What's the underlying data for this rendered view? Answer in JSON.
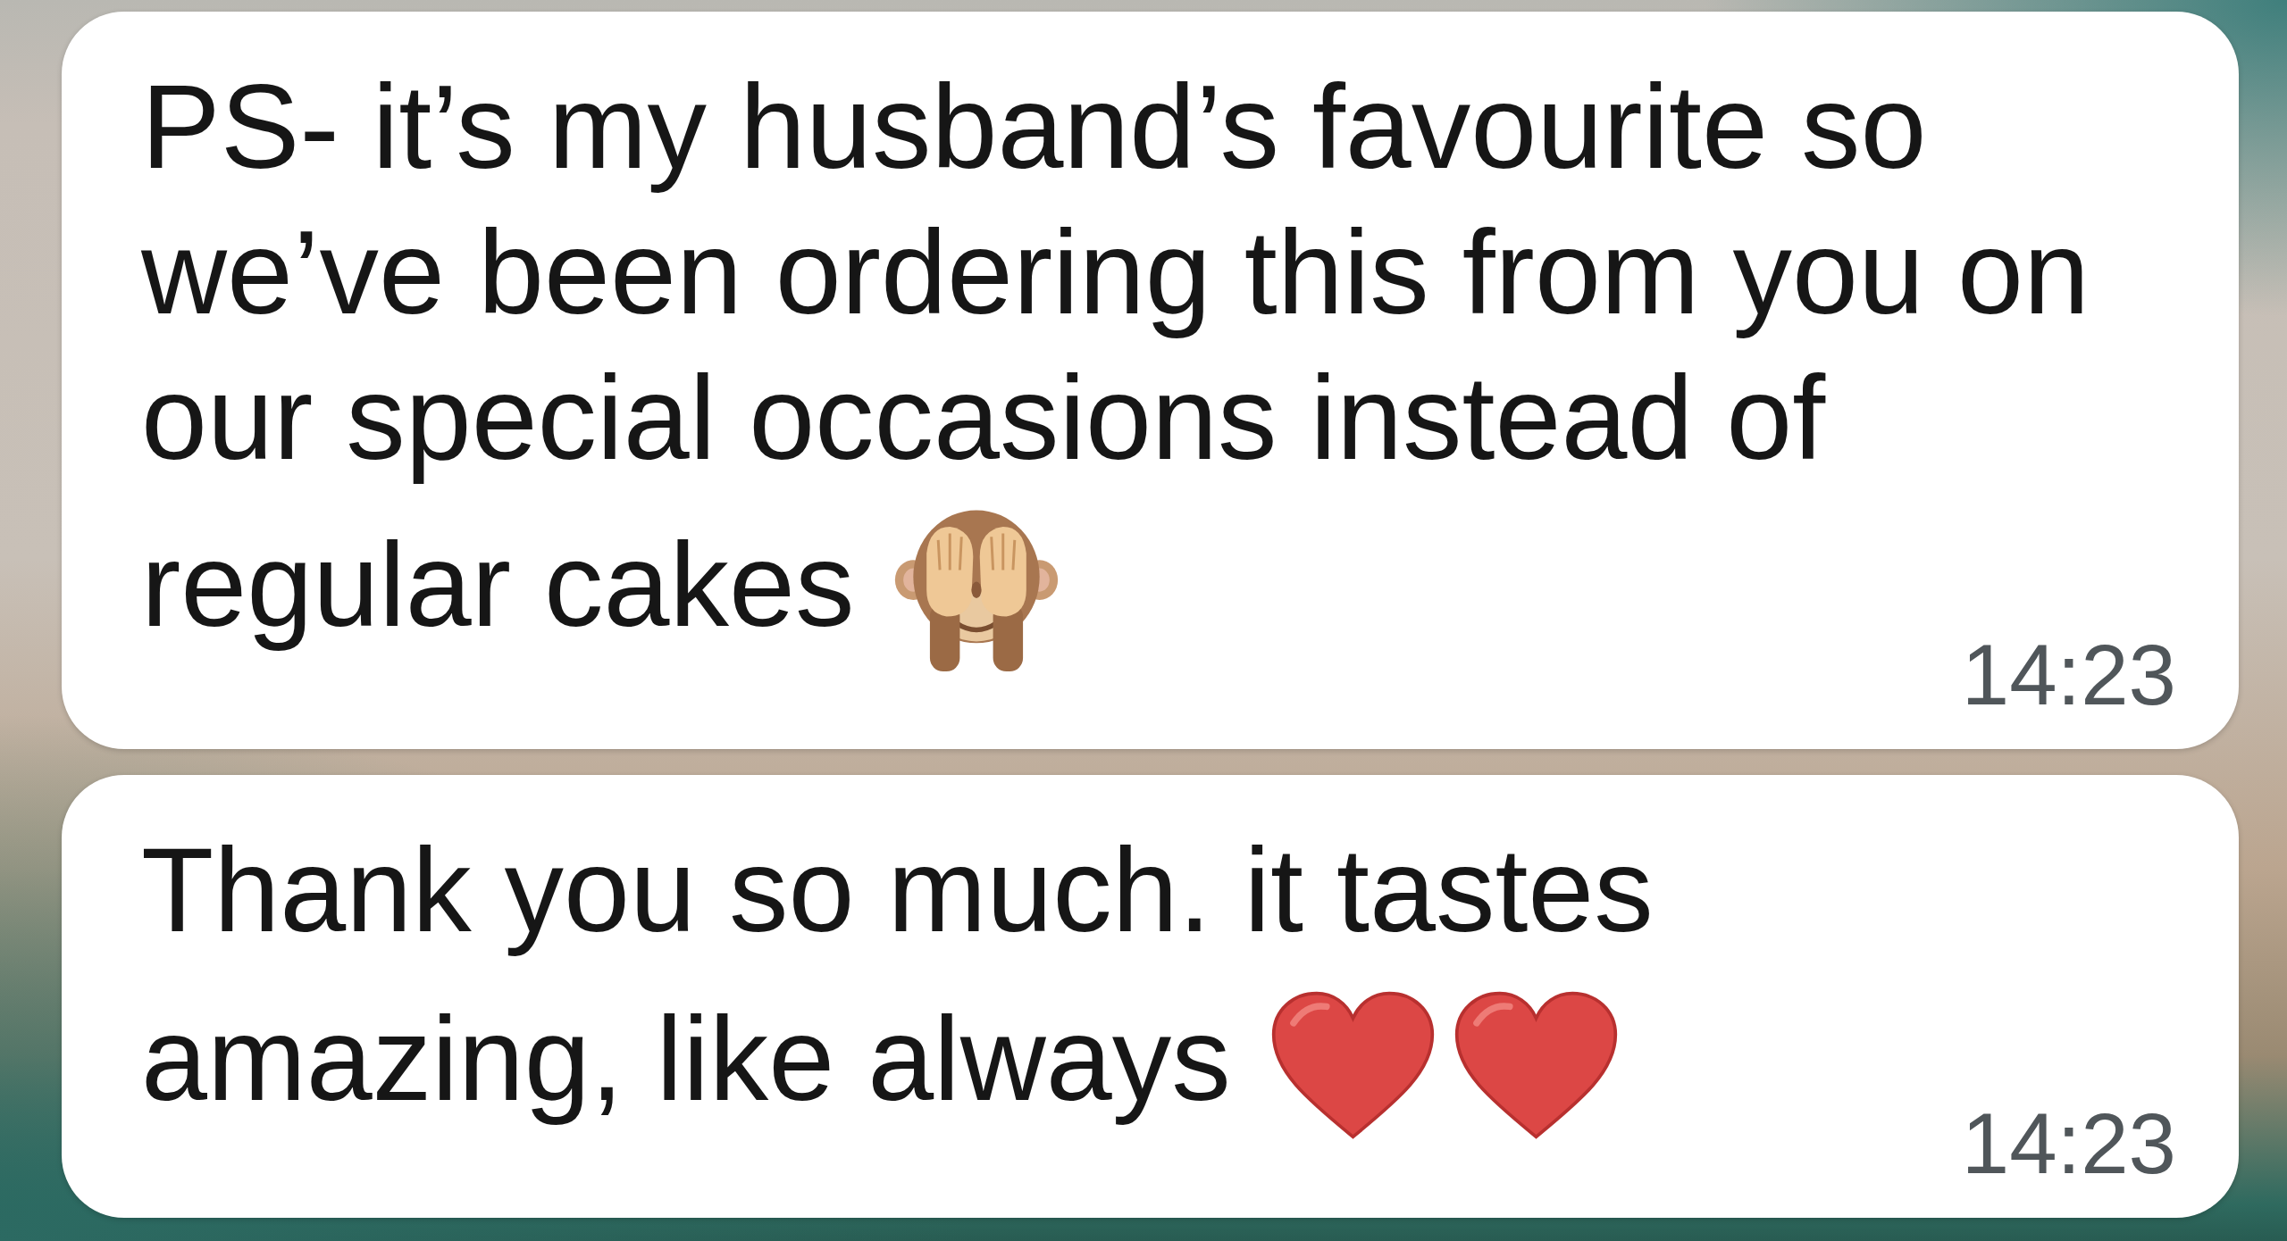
{
  "messages": [
    {
      "lines": [
        "PS- it’s my husband’s favourite so",
        "we’ve been ordering this from you on",
        "our special occasions instead of",
        "regular cakes"
      ],
      "emoji": [
        {
          "kind": "monkey"
        }
      ],
      "time": "14:23"
    },
    {
      "lines": [
        "Thank you so much. it tastes",
        "amazing, like always"
      ],
      "emoji": [
        {
          "kind": "heart"
        },
        {
          "kind": "heart"
        }
      ],
      "time": "14:23"
    }
  ]
}
